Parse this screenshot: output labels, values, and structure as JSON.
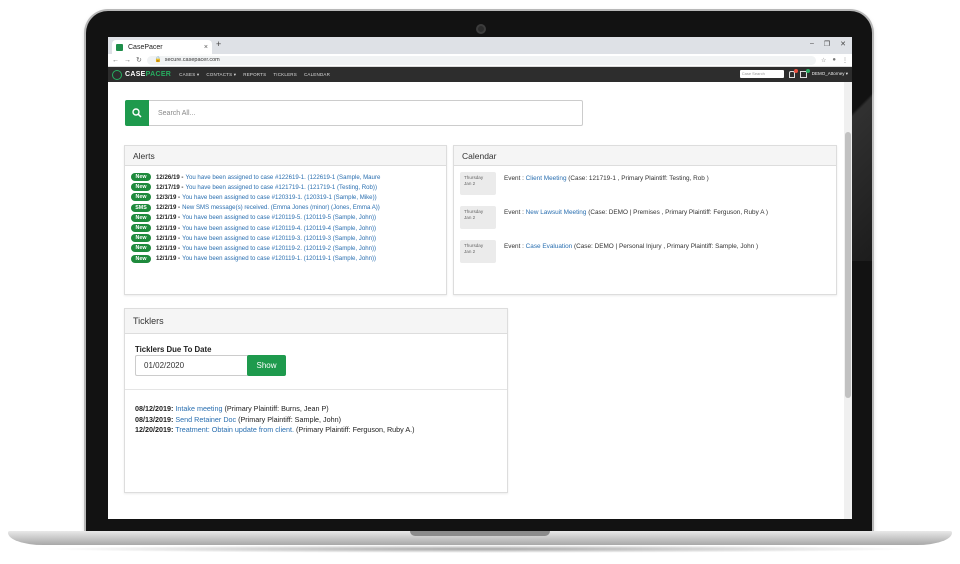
{
  "browser": {
    "tab_title": "CasePacer",
    "tab_close": "×",
    "new_tab": "+",
    "url": "secure.casepacer.com",
    "min": "–",
    "restore": "❐",
    "close": "✕"
  },
  "app_nav": {
    "logo_a": "CASE",
    "logo_b": "PACER",
    "links": [
      "CASES ▾",
      "CONTACTS ▾",
      "REPORTS",
      "TICKLERS",
      "CALENDAR"
    ],
    "case_search_placeholder": "Case Search",
    "user": "DEMO_Attorney ▾"
  },
  "search": {
    "placeholder": "Search All..."
  },
  "alerts": {
    "title": "Alerts",
    "items": [
      {
        "badge": "New",
        "date": "12/26/19 -",
        "text": "You have been assigned to case #122619-1. (122619-1 (Sample, Maure"
      },
      {
        "badge": "New",
        "date": "12/17/19 -",
        "text": "You have been assigned to case #121719-1. (121719-1 (Testing, Rob))"
      },
      {
        "badge": "New",
        "date": "12/3/19 -",
        "text": "You have been assigned to case #120319-1. (120319-1 (Sample, Mike))"
      },
      {
        "badge": "SMS",
        "date": "12/2/19 -",
        "text": "New SMS message(s) received. (Emma Jones (minor) (Jones, Emma A))"
      },
      {
        "badge": "New",
        "date": "12/1/19 -",
        "text": "You have been assigned to case #120119-5. (120119-5 (Sample, John))"
      },
      {
        "badge": "New",
        "date": "12/1/19 -",
        "text": "You have been assigned to case #120119-4. (120119-4 (Sample, John))"
      },
      {
        "badge": "New",
        "date": "12/1/19 -",
        "text": "You have been assigned to case #120119-3. (120119-3 (Sample, John))"
      },
      {
        "badge": "New",
        "date": "12/1/19 -",
        "text": "You have been assigned to case #120119-2. (120119-2 (Sample, John))"
      },
      {
        "badge": "New",
        "date": "12/1/19 -",
        "text": "You have been assigned to case #120119-1. (120119-1 (Sample, John))"
      }
    ]
  },
  "calendar": {
    "title": "Calendar",
    "events": [
      {
        "day": "Thursday",
        "date": "Jan 2",
        "prefix": "Event : ",
        "link": "Client Meeting",
        "details": " (Case: 121719-1 , Primary Plaintiff: Testing, Rob )"
      },
      {
        "day": "Thursday",
        "date": "Jan 2",
        "prefix": "Event : ",
        "link": "New Lawsuit Meeting",
        "details": " (Case: DEMO | Premises , Primary Plaintiff: Ferguson, Ruby A )"
      },
      {
        "day": "Thursday",
        "date": "Jan 2",
        "prefix": "Event : ",
        "link": "Case Evaluation",
        "details": " (Case: DEMO | Personal Injury , Primary Plaintiff: Sample, John )"
      }
    ]
  },
  "ticklers": {
    "title": "Ticklers",
    "due_label": "Ticklers Due To Date",
    "date_value": "01/02/2020",
    "show_button": "Show",
    "items": [
      {
        "date": "08/12/2019:",
        "link": "Intake meeting",
        "details": " (Primary Plaintiff: Burns, Jean P)"
      },
      {
        "date": "08/13/2019:",
        "link": "Send Retainer Doc",
        "details": " (Primary Plaintiff: Sample, John)"
      },
      {
        "date": "12/20/2019:",
        "link": "Treatment: Obtain update from client.",
        "details": " (Primary Plaintiff: Ferguson, Ruby A.)"
      }
    ]
  },
  "colors": {
    "brand_green": "#1e9a4d",
    "badge_green": "#1e8a3c",
    "link_blue": "#2a6fb0",
    "nav_dark": "#2d2d2d"
  }
}
